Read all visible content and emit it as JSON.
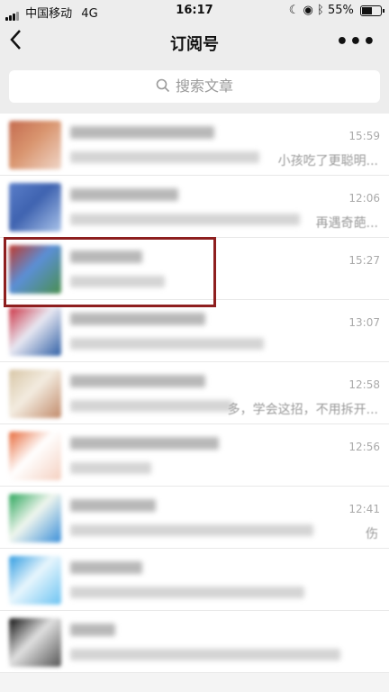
{
  "status_bar": {
    "carrier": "中国移动",
    "network": "4G",
    "time": "16:17",
    "battery": "55%",
    "battery_level": 0.55
  },
  "header": {
    "title": "订阅号",
    "back_icon": "chevron-left-icon",
    "more_icon": "more-dots-icon"
  },
  "search": {
    "placeholder": "搜索文章"
  },
  "subscriptions": [
    {
      "time": "15:59",
      "preview": "小孩吃了更聪明...",
      "avatar_colors": [
        "#c46b4f",
        "#f0d6c8",
        "#d9956f"
      ]
    },
    {
      "time": "12:06",
      "preview": "再遇奇葩...",
      "avatar_colors": [
        "#5a7ec9",
        "#a9c3ea",
        "#3f63b0"
      ]
    },
    {
      "time": "15:27",
      "preview": "",
      "avatar_colors": [
        "#c0392b",
        "#4a8f4f",
        "#5b8fd6"
      ]
    },
    {
      "time": "13:07",
      "preview": "",
      "avatar_colors": [
        "#cc3344",
        "#2f5fa5",
        "#e8e8f2"
      ]
    },
    {
      "time": "12:58",
      "preview": "多，学会这招，不用拆开...",
      "avatar_colors": [
        "#d8c6a6",
        "#c18a6a",
        "#f3ece0"
      ]
    },
    {
      "time": "12:56",
      "preview": "",
      "avatar_colors": [
        "#e76a3b",
        "#f5d0c0",
        "#ffffff"
      ]
    },
    {
      "time": "12:41",
      "preview": "伤",
      "avatar_colors": [
        "#2aa55a",
        "#3a8fd9",
        "#f0f6ee"
      ]
    },
    {
      "time": "",
      "preview": "",
      "avatar_colors": [
        "#2f9be0",
        "#6cc3f2",
        "#e8f6fd"
      ]
    },
    {
      "time": "",
      "preview": "",
      "avatar_colors": [
        "#111111",
        "#555555",
        "#e0e0e0"
      ]
    }
  ]
}
